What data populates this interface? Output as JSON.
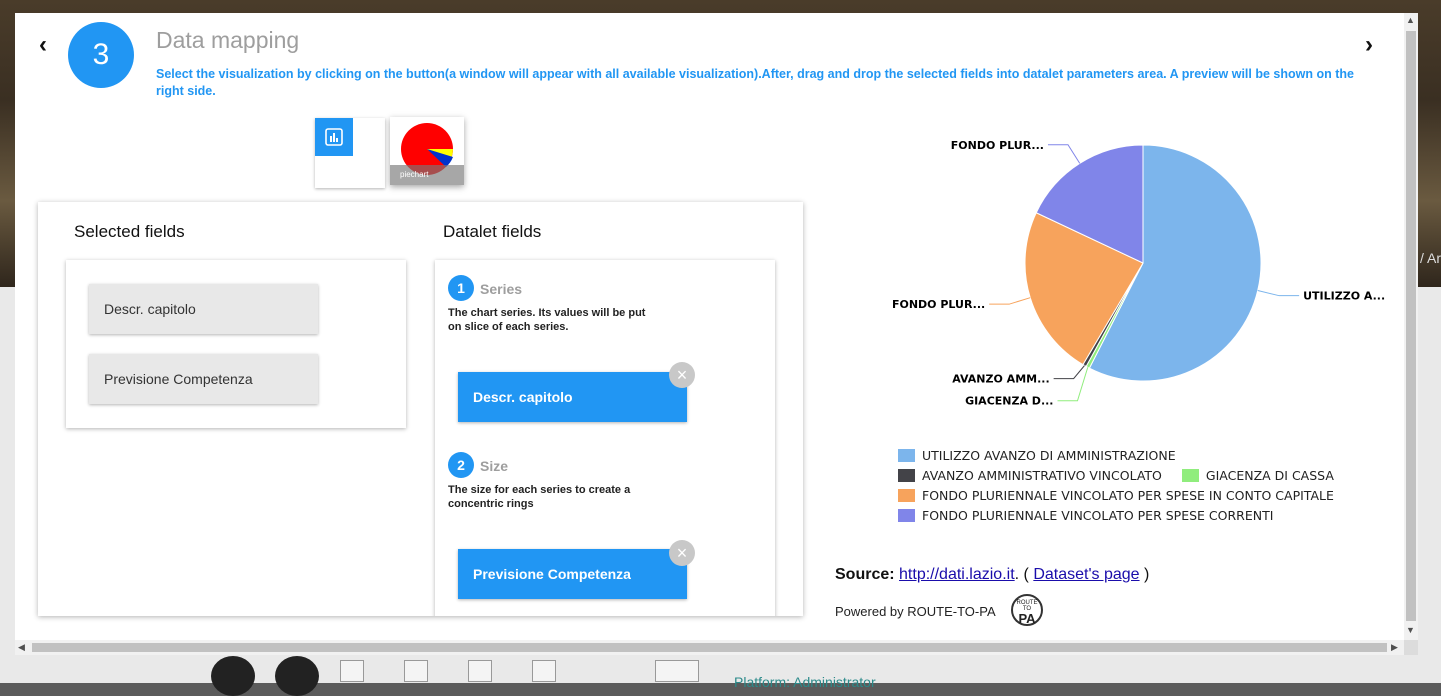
{
  "background": {
    "edge_text": "/ Ar",
    "link": "Platform: Administrator"
  },
  "step": {
    "number": "3",
    "title": "Data mapping",
    "description": "Select the visualization by clicking on the button(a window will appear with all available visualization).After, drag and drop the selected fields into datalet parameters area. A preview will be shown on the right side."
  },
  "visualization": {
    "selected_label": "piechart",
    "chart_icon": "bar-chart-icon"
  },
  "selected_fields": {
    "title": "Selected fields",
    "items": [
      "Descr. capitolo",
      "Previsione Competenza"
    ]
  },
  "datalet_fields": {
    "title": "Datalet fields",
    "params": [
      {
        "number": "1",
        "name": "Series",
        "description": "The chart series. Its values will be put on slice of each series.",
        "value": "Descr. capitolo"
      },
      {
        "number": "2",
        "name": "Size",
        "description": "The size for each series to create a concentric rings",
        "value": "Previsione Competenza"
      }
    ]
  },
  "chart_data": {
    "type": "pie",
    "title": "",
    "series": [
      {
        "name": "UTILIZZO AVANZO DI AMMINISTRAZIONE",
        "label": "UTILIZZO A...",
        "value": 57.5,
        "color": "#7cb5ec"
      },
      {
        "name": "GIACENZA DI CASSA",
        "label": "GIACENZA D...",
        "value": 0.5,
        "color": "#90ed7d"
      },
      {
        "name": "AVANZO AMMINISTRATIVO VINCOLATO",
        "label": "AVANZO AMM...",
        "value": 0.5,
        "color": "#434348"
      },
      {
        "name": "FONDO PLURIENNALE VINCOLATO PER SPESE IN CONTO CAPITALE",
        "label": "FONDO PLUR...",
        "value": 23.5,
        "color": "#f7a35c"
      },
      {
        "name": "FONDO PLURIENNALE VINCOLATO PER SPESE CORRENTI",
        "label": "FONDO PLUR...",
        "value": 18.0,
        "color": "#8085e9"
      }
    ],
    "legend_order": [
      0,
      2,
      1,
      3,
      4
    ],
    "legend_placement": "bottom"
  },
  "footer": {
    "source_label": "Source:",
    "source_link": "http://dati.lazio.it",
    "dataset_link": "Dataset's page",
    "powered_by": "Powered by ROUTE-TO-PA",
    "logo_top": "ROUTE TO",
    "logo_bottom": "PA"
  }
}
